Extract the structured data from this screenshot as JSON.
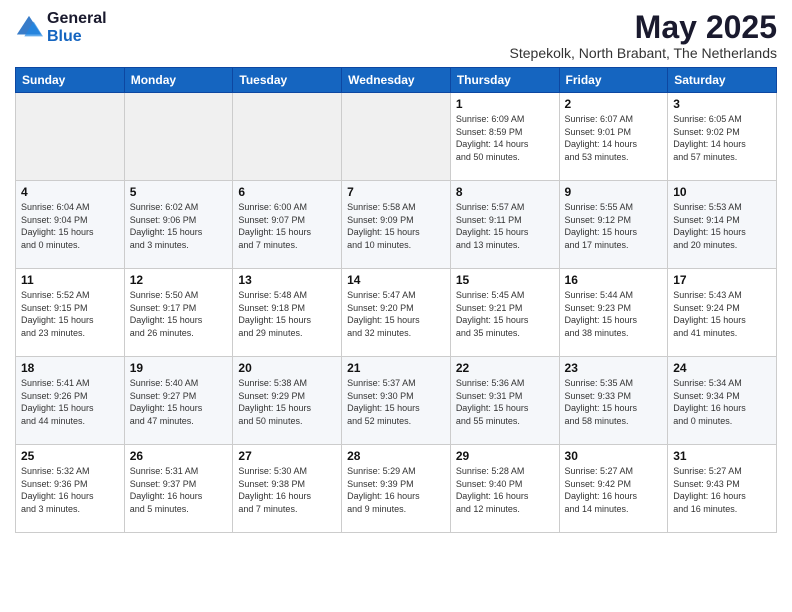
{
  "logo": {
    "general": "General",
    "blue": "Blue"
  },
  "title": "May 2025",
  "subtitle": "Stepekolk, North Brabant, The Netherlands",
  "days_header": [
    "Sunday",
    "Monday",
    "Tuesday",
    "Wednesday",
    "Thursday",
    "Friday",
    "Saturday"
  ],
  "weeks": [
    [
      {
        "num": "",
        "info": ""
      },
      {
        "num": "",
        "info": ""
      },
      {
        "num": "",
        "info": ""
      },
      {
        "num": "",
        "info": ""
      },
      {
        "num": "1",
        "info": "Sunrise: 6:09 AM\nSunset: 8:59 PM\nDaylight: 14 hours\nand 50 minutes."
      },
      {
        "num": "2",
        "info": "Sunrise: 6:07 AM\nSunset: 9:01 PM\nDaylight: 14 hours\nand 53 minutes."
      },
      {
        "num": "3",
        "info": "Sunrise: 6:05 AM\nSunset: 9:02 PM\nDaylight: 14 hours\nand 57 minutes."
      }
    ],
    [
      {
        "num": "4",
        "info": "Sunrise: 6:04 AM\nSunset: 9:04 PM\nDaylight: 15 hours\nand 0 minutes."
      },
      {
        "num": "5",
        "info": "Sunrise: 6:02 AM\nSunset: 9:06 PM\nDaylight: 15 hours\nand 3 minutes."
      },
      {
        "num": "6",
        "info": "Sunrise: 6:00 AM\nSunset: 9:07 PM\nDaylight: 15 hours\nand 7 minutes."
      },
      {
        "num": "7",
        "info": "Sunrise: 5:58 AM\nSunset: 9:09 PM\nDaylight: 15 hours\nand 10 minutes."
      },
      {
        "num": "8",
        "info": "Sunrise: 5:57 AM\nSunset: 9:11 PM\nDaylight: 15 hours\nand 13 minutes."
      },
      {
        "num": "9",
        "info": "Sunrise: 5:55 AM\nSunset: 9:12 PM\nDaylight: 15 hours\nand 17 minutes."
      },
      {
        "num": "10",
        "info": "Sunrise: 5:53 AM\nSunset: 9:14 PM\nDaylight: 15 hours\nand 20 minutes."
      }
    ],
    [
      {
        "num": "11",
        "info": "Sunrise: 5:52 AM\nSunset: 9:15 PM\nDaylight: 15 hours\nand 23 minutes."
      },
      {
        "num": "12",
        "info": "Sunrise: 5:50 AM\nSunset: 9:17 PM\nDaylight: 15 hours\nand 26 minutes."
      },
      {
        "num": "13",
        "info": "Sunrise: 5:48 AM\nSunset: 9:18 PM\nDaylight: 15 hours\nand 29 minutes."
      },
      {
        "num": "14",
        "info": "Sunrise: 5:47 AM\nSunset: 9:20 PM\nDaylight: 15 hours\nand 32 minutes."
      },
      {
        "num": "15",
        "info": "Sunrise: 5:45 AM\nSunset: 9:21 PM\nDaylight: 15 hours\nand 35 minutes."
      },
      {
        "num": "16",
        "info": "Sunrise: 5:44 AM\nSunset: 9:23 PM\nDaylight: 15 hours\nand 38 minutes."
      },
      {
        "num": "17",
        "info": "Sunrise: 5:43 AM\nSunset: 9:24 PM\nDaylight: 15 hours\nand 41 minutes."
      }
    ],
    [
      {
        "num": "18",
        "info": "Sunrise: 5:41 AM\nSunset: 9:26 PM\nDaylight: 15 hours\nand 44 minutes."
      },
      {
        "num": "19",
        "info": "Sunrise: 5:40 AM\nSunset: 9:27 PM\nDaylight: 15 hours\nand 47 minutes."
      },
      {
        "num": "20",
        "info": "Sunrise: 5:38 AM\nSunset: 9:29 PM\nDaylight: 15 hours\nand 50 minutes."
      },
      {
        "num": "21",
        "info": "Sunrise: 5:37 AM\nSunset: 9:30 PM\nDaylight: 15 hours\nand 52 minutes."
      },
      {
        "num": "22",
        "info": "Sunrise: 5:36 AM\nSunset: 9:31 PM\nDaylight: 15 hours\nand 55 minutes."
      },
      {
        "num": "23",
        "info": "Sunrise: 5:35 AM\nSunset: 9:33 PM\nDaylight: 15 hours\nand 58 minutes."
      },
      {
        "num": "24",
        "info": "Sunrise: 5:34 AM\nSunset: 9:34 PM\nDaylight: 16 hours\nand 0 minutes."
      }
    ],
    [
      {
        "num": "25",
        "info": "Sunrise: 5:32 AM\nSunset: 9:36 PM\nDaylight: 16 hours\nand 3 minutes."
      },
      {
        "num": "26",
        "info": "Sunrise: 5:31 AM\nSunset: 9:37 PM\nDaylight: 16 hours\nand 5 minutes."
      },
      {
        "num": "27",
        "info": "Sunrise: 5:30 AM\nSunset: 9:38 PM\nDaylight: 16 hours\nand 7 minutes."
      },
      {
        "num": "28",
        "info": "Sunrise: 5:29 AM\nSunset: 9:39 PM\nDaylight: 16 hours\nand 9 minutes."
      },
      {
        "num": "29",
        "info": "Sunrise: 5:28 AM\nSunset: 9:40 PM\nDaylight: 16 hours\nand 12 minutes."
      },
      {
        "num": "30",
        "info": "Sunrise: 5:27 AM\nSunset: 9:42 PM\nDaylight: 16 hours\nand 14 minutes."
      },
      {
        "num": "31",
        "info": "Sunrise: 5:27 AM\nSunset: 9:43 PM\nDaylight: 16 hours\nand 16 minutes."
      }
    ]
  ]
}
